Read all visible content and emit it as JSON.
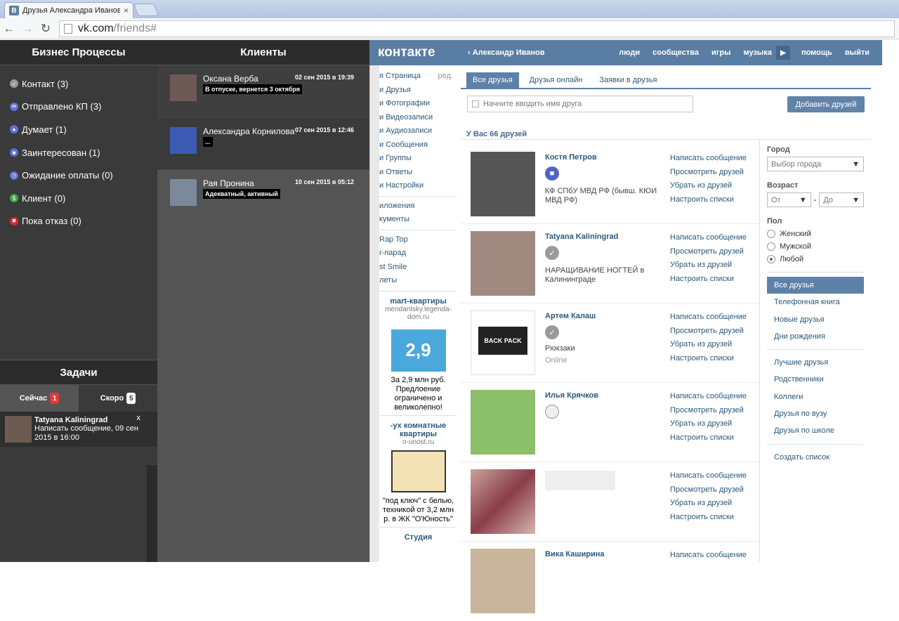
{
  "browser": {
    "tab_title": "Друзья Александра Иванов",
    "tab_close": "×",
    "url_host": "vk.com",
    "url_path": "/friends#"
  },
  "vk": {
    "logo": "контакте",
    "user": "Александр Иванов",
    "nav": [
      "люди",
      "сообщества",
      "игры",
      "музыка",
      "помощь",
      "выйти"
    ],
    "left_menu": [
      "я Страница",
      "и Друзья",
      "и Фотографии",
      "и Видеозаписи",
      "и Аудиозаписи",
      "и Сообщения",
      "и Группы",
      "и Ответы",
      "и Настройки"
    ],
    "left_menu_edit": "ред.",
    "left_menu2": [
      "иложения",
      "кументы"
    ],
    "left_menu3": [
      "Rap Top",
      "r-парад",
      "st Smile",
      "леты"
    ],
    "ad1": {
      "title": "mart-квартиры",
      "sub": "mendantsky.legenda-dom.ru",
      "price": "2,9",
      "text": "За 2,9 млн руб. Предлоение ограничено и великолепно!"
    },
    "ad2": {
      "title": "-ух комнатные квартиры",
      "sub": "o-unost.ru",
      "text": "\"под ключ\" с белью, техникой от 3,2 млн р. в ЖК \"О'Юность\""
    },
    "ad3": {
      "title": "Студия"
    },
    "tabs": [
      "Все друзья",
      "Друзья онлайн",
      "Заявки в друзья"
    ],
    "search_placeholder": "Начните вводить имя друга",
    "add_friends": "Добавить друзей",
    "count": "У Вас 66 друзей",
    "actions": [
      "Написать сообщение",
      "Просмотреть друзей",
      "Убрать из друзей",
      "Настроить списки"
    ],
    "friends": [
      {
        "name": "Костя Петров",
        "desc": "КФ СПбУ МВД РФ (бывш. КЮИ МВД РФ)",
        "online": ""
      },
      {
        "name": "Tatyana Kaliningrad",
        "desc": "НАРАЩИВАНИЕ НОГТЕЙ в Калининграде",
        "online": ""
      },
      {
        "name": "Артем Калаш",
        "desc": "Рюкзаки",
        "online": "Online"
      },
      {
        "name": "Илья Крячков",
        "desc": "",
        "online": ""
      },
      {
        "name": "",
        "desc": "",
        "online": ""
      },
      {
        "name": "Вика Каширина",
        "desc": "",
        "online": ""
      }
    ],
    "filters": {
      "city_label": "Город",
      "city_value": "Выбор города",
      "age_label": "Возраст",
      "age_from": "От",
      "age_to": "До",
      "age_dash": "-",
      "sex_label": "Пол",
      "sex_options": [
        "Женский",
        "Мужской",
        "Любой"
      ],
      "lists1": [
        "Все друзья",
        "Телефонная книга",
        "Новые друзья",
        "Дни рождения"
      ],
      "lists2": [
        "Лучшие друзья",
        "Родственники",
        "Коллеги",
        "Друзья по вузу",
        "Друзья по школе"
      ],
      "create_list": "Создать список"
    }
  },
  "business": {
    "title": "Бизнес Процессы",
    "items": [
      {
        "label": "Контакт (3)",
        "icon": "check-icon",
        "color": "#9a9a9a"
      },
      {
        "label": "Отправлено КП (3)",
        "icon": "mail-icon",
        "color": "#5d6fd6"
      },
      {
        "label": "Думает (1)",
        "icon": "person-icon",
        "color": "#5d6fd6"
      },
      {
        "label": "Заинтересован (1)",
        "icon": "briefcase-icon",
        "color": "#5d6fd6"
      },
      {
        "label": "Ожидание оплаты (0)",
        "icon": "clock-icon",
        "color": "#5d6fd6"
      },
      {
        "label": "Клиент (0)",
        "icon": "dollar-icon",
        "color": "#3fa447"
      },
      {
        "label": "Пока отказ (0)",
        "icon": "cross-icon",
        "color": "#d9262a"
      }
    ]
  },
  "tasks": {
    "title": "Задачи",
    "tabs": [
      {
        "label": "Сейчас",
        "badge": "1"
      },
      {
        "label": "Скоро",
        "badge": "5"
      }
    ],
    "item": {
      "name": "Tatyana Kaliningrad",
      "text": "Написать сообщение, 09 сен 2015 в 16:00",
      "close": "x"
    }
  },
  "clients": {
    "title": "Клиенты",
    "items": [
      {
        "name": "Оксана Верба",
        "date": "02 сен 2015 в 19:39",
        "note": "В отпуске, вернется 3 октября"
      },
      {
        "name": "Александра Корнилова",
        "date": "07 сен 2015 в 12:46",
        "note": "..."
      },
      {
        "name": "Рая Пронина",
        "date": "10 сен 2015 в 05:12",
        "note": "Адекватный, активный"
      }
    ]
  }
}
